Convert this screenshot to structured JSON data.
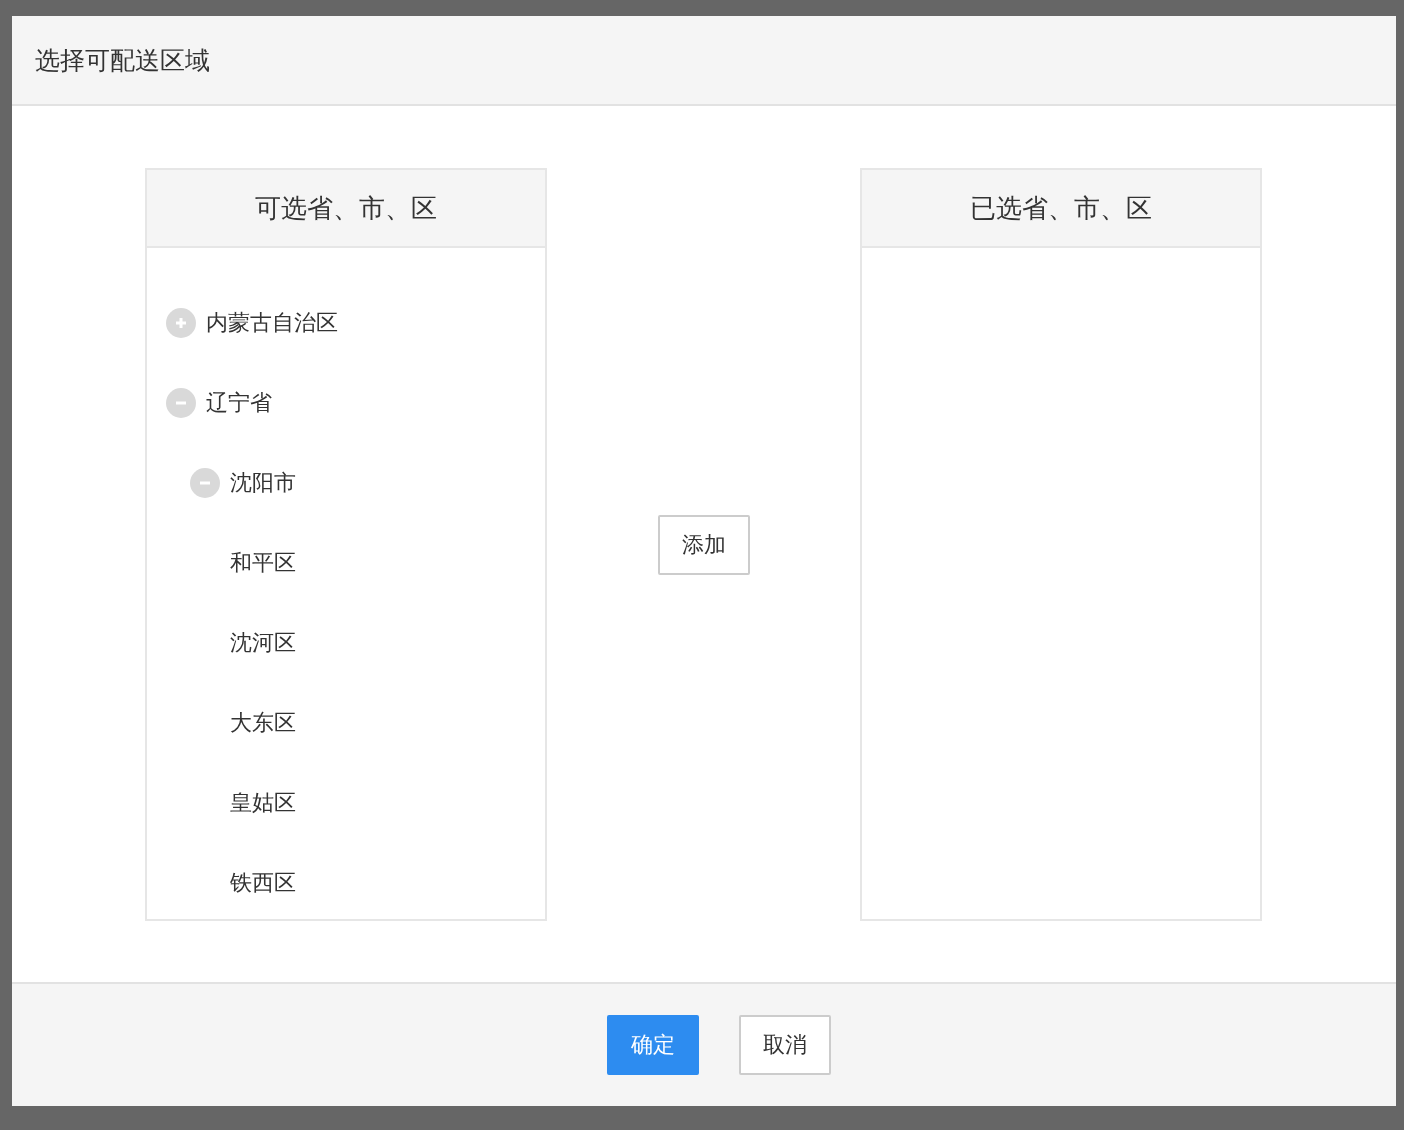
{
  "dialog": {
    "title": "选择可配送区域",
    "available_panel": {
      "title": "可选省、市、区",
      "tree": [
        {
          "label": "内蒙古自治区",
          "expanded": false
        },
        {
          "label": "辽宁省",
          "expanded": true,
          "children": [
            {
              "label": "沈阳市",
              "expanded": true,
              "children": [
                {
                  "label": "和平区"
                },
                {
                  "label": "沈河区"
                },
                {
                  "label": "大东区"
                },
                {
                  "label": "皇姑区"
                },
                {
                  "label": "铁西区"
                }
              ]
            }
          ]
        }
      ]
    },
    "add_button": "添加",
    "selected_panel": {
      "title": "已选省、市、区"
    },
    "buttons": [
      {
        "label": "确定",
        "kind": "primary"
      },
      {
        "label": "取消",
        "kind": "default"
      }
    ]
  }
}
